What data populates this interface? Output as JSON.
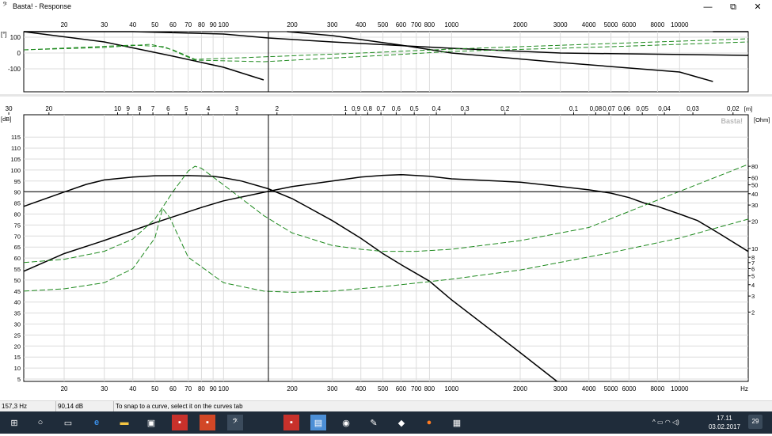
{
  "window": {
    "title": "Basta! - Response",
    "app_icon": "basta-icon",
    "controls": {
      "minimize": "—",
      "maximize": "⧉",
      "close": "✕"
    }
  },
  "phase_panel": {
    "unit_label": "[°]",
    "y_ticks": [
      "100",
      "0",
      "-100"
    ],
    "freq_ticks": [
      "20",
      "30",
      "40",
      "50",
      "60",
      "70",
      "80",
      "90",
      "100",
      "200",
      "300",
      "400",
      "500",
      "600",
      "700",
      "800",
      "1000",
      "2000",
      "3000",
      "4000",
      "5000",
      "6000",
      "8000",
      "10000"
    ],
    "cursor_freq_hz": 157.3
  },
  "spl_panel": {
    "db_unit": "[dB]",
    "ohm_unit": "[Ohm]",
    "wavelength_unit": "[m]",
    "watermark": "Basta!",
    "db_ticks": [
      "115",
      "110",
      "105",
      "100",
      "95",
      "90",
      "85",
      "80",
      "75",
      "70",
      "65",
      "60",
      "55",
      "50",
      "45",
      "40",
      "35",
      "30",
      "25",
      "20",
      "15",
      "10",
      "5"
    ],
    "ohm_ticks": [
      "80",
      "60",
      "50",
      "40",
      "30",
      "20",
      "10",
      "8",
      "7",
      "6",
      "5",
      "4",
      "3",
      "2"
    ],
    "wavelength_ticks": [
      "30",
      "20",
      "10",
      "9",
      "8",
      "7",
      "6",
      "5",
      "4",
      "3",
      "2",
      "1",
      "0,9",
      "0,8",
      "0,7",
      "0,6",
      "0,5",
      "0,4",
      "0,3",
      "0,2",
      "0,1",
      "0,08",
      "0,07",
      "0,06",
      "0,05",
      "0,04",
      "0,03",
      "0,02"
    ],
    "freq_ticks": [
      "20",
      "30",
      "40",
      "50",
      "60",
      "70",
      "80",
      "90",
      "100",
      "200",
      "300",
      "400",
      "500",
      "600",
      "700",
      "800",
      "1000",
      "2000",
      "3000",
      "4000",
      "5000",
      "6000",
      "8000",
      "10000"
    ],
    "hz_label": "Hz",
    "cursor_freq_hz": 157.3,
    "cursor_db": 90.14
  },
  "status": {
    "freq": "157,3 Hz",
    "level": "90,14 dB",
    "hint": "To snap to a curve, select it on the curves tab"
  },
  "taskbar": {
    "icons": [
      "windows-start-icon",
      "search-icon",
      "task-view-icon",
      "edge-icon",
      "file-explorer-icon",
      "store-icon",
      "app-red-icon",
      "app-pdf-icon",
      "basta-taskbar-icon",
      "app-presentation-icon",
      "app-notepad-icon",
      "app-media-icon",
      "app-wolf-icon",
      "firefox-icon",
      "calculator-icon"
    ],
    "tray_symbols": "^ ▭ ◠ ◁)",
    "time": "17.11",
    "date": "03.02.2017",
    "notifications": "29"
  }
}
